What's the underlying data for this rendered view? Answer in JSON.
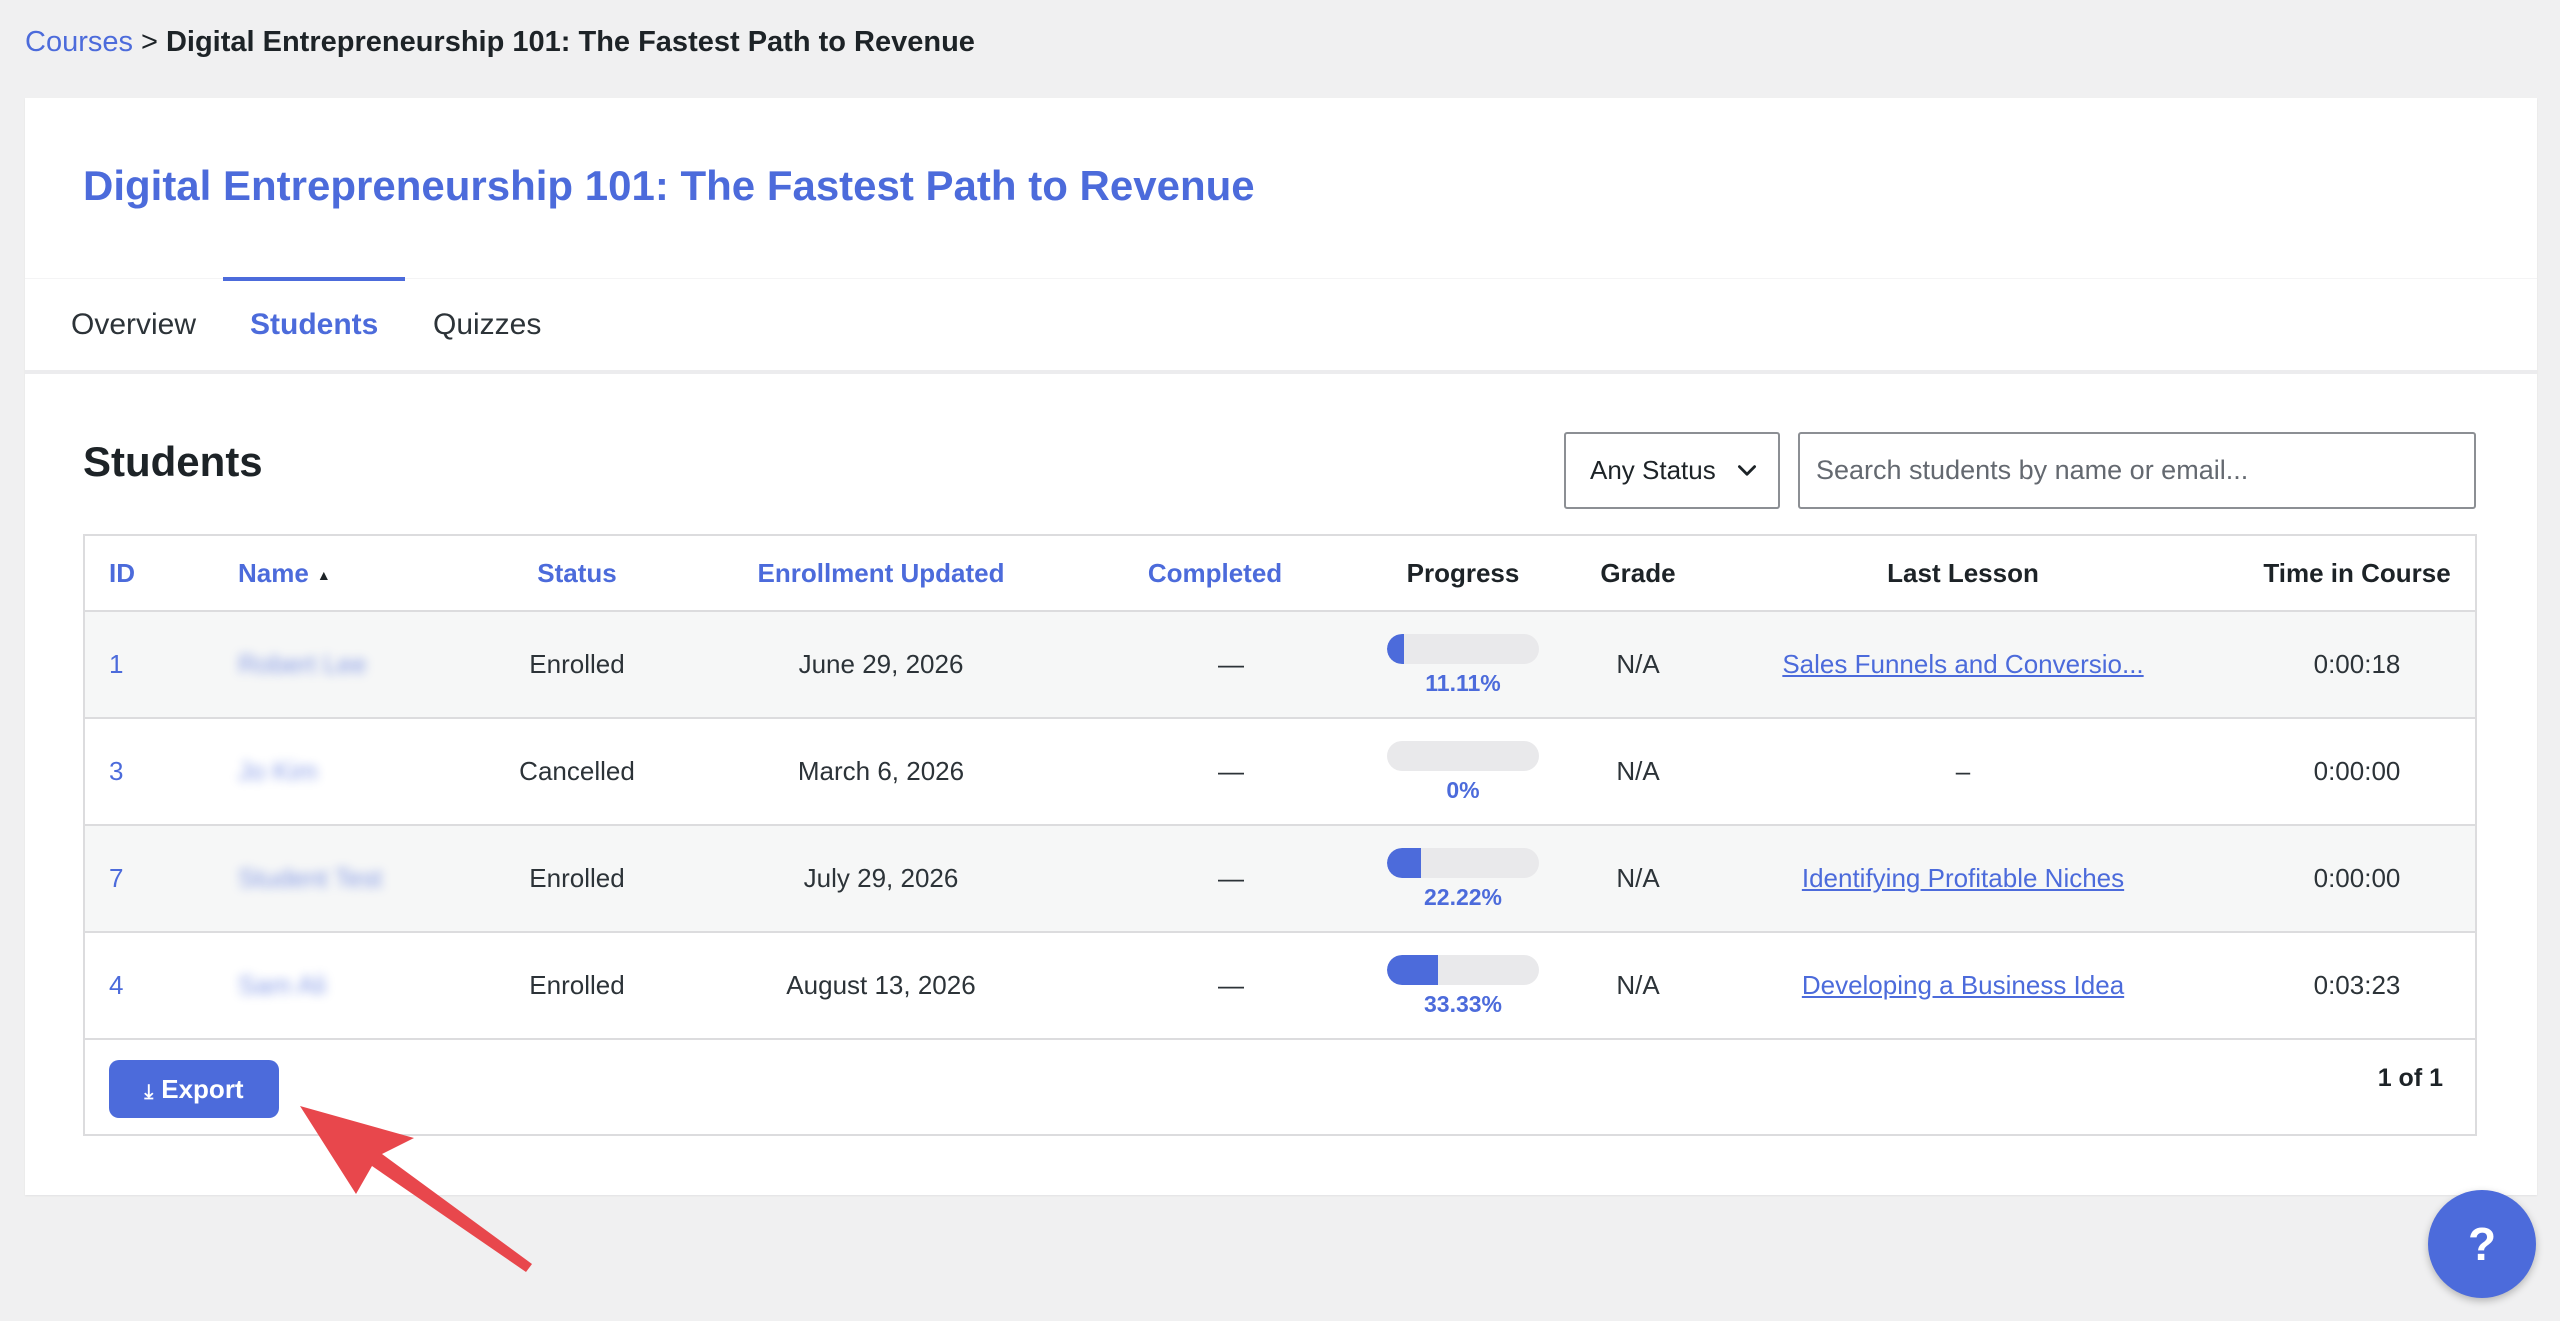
{
  "breadcrumb": {
    "parent": "Courses",
    "separator": ">",
    "current": "Digital Entrepreneurship 101: The Fastest Path to Revenue"
  },
  "course": {
    "title": "Digital Entrepreneurship 101: The Fastest Path to Revenue"
  },
  "tabs": [
    {
      "label": "Overview",
      "active": false
    },
    {
      "label": "Students",
      "active": true
    },
    {
      "label": "Quizzes",
      "active": false
    }
  ],
  "students_section": {
    "title": "Students",
    "status_filter": {
      "selected": "Any Status"
    },
    "search": {
      "placeholder": "Search students by name or email...",
      "value": ""
    }
  },
  "table": {
    "columns": [
      "ID",
      "Name",
      "Status",
      "Enrollment Updated",
      "Completed",
      "Progress",
      "Grade",
      "Last Lesson",
      "Time in Course"
    ],
    "sort_column": "Name",
    "rows": [
      {
        "id": "1",
        "name": "Robert Lee",
        "status": "Enrolled",
        "enrollment_updated": "June 29, 2026",
        "completed": "—",
        "progress": 11.11,
        "progress_label": "11.11%",
        "grade": "N/A",
        "last_lesson": "Sales Funnels and Conversio...",
        "last_lesson_link": true,
        "time": "0:00:18"
      },
      {
        "id": "3",
        "name": "Jo Kim",
        "status": "Cancelled",
        "enrollment_updated": "March 6, 2026",
        "completed": "—",
        "progress": 0,
        "progress_label": "0%",
        "grade": "N/A",
        "last_lesson": "–",
        "last_lesson_link": false,
        "time": "0:00:00"
      },
      {
        "id": "7",
        "name": "Student Test",
        "status": "Enrolled",
        "enrollment_updated": "July 29, 2026",
        "completed": "—",
        "progress": 22.22,
        "progress_label": "22.22%",
        "grade": "N/A",
        "last_lesson": "Identifying Profitable Niches",
        "last_lesson_link": true,
        "time": "0:00:00"
      },
      {
        "id": "4",
        "name": "Sam Ali",
        "status": "Enrolled",
        "enrollment_updated": "August 13, 2026",
        "completed": "—",
        "progress": 33.33,
        "progress_label": "33.33%",
        "grade": "N/A",
        "last_lesson": "Developing a Business Idea",
        "last_lesson_link": true,
        "time": "0:03:23"
      }
    ],
    "export_label": "Export",
    "pagination": "1 of 1"
  },
  "help": {
    "label": "?"
  },
  "colors": {
    "accent": "#4c6bdb",
    "background": "#f0f0f1",
    "annotation_arrow": "#e8474c"
  },
  "icons": {
    "sort": "sort-asc-icon",
    "select": "chevron-down-icon",
    "export": "download-icon",
    "annotation": "arrow-annotation"
  }
}
